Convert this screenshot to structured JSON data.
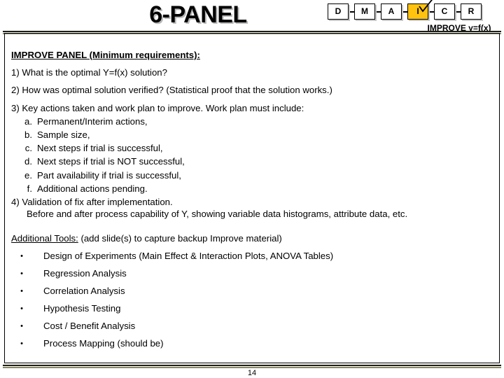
{
  "header": {
    "title": "6-PANEL",
    "phase_label": "IMPROVE y=f(x)",
    "roadmap": {
      "steps": [
        {
          "label": "D",
          "active": false
        },
        {
          "label": "M",
          "active": false
        },
        {
          "label": "A",
          "active": false
        },
        {
          "label": "I",
          "active": true
        },
        {
          "label": "C",
          "active": false
        },
        {
          "label": "R",
          "active": false
        }
      ],
      "active_marker_icon": "checkmark-icon",
      "active_color": "#FFC20E"
    }
  },
  "body": {
    "section_heading": "IMPROVE PANEL  (Minimum requirements):",
    "numbered_items": [
      "1) What is the optimal Y=f(x) solution?",
      "2) How was optimal solution verified?  (Statistical proof that the solution works.)",
      "3) Key actions taken and work plan to improve.  Work plan must include:"
    ],
    "sub_items": [
      {
        "marker": "a.",
        "text": "Permanent/Interim actions,"
      },
      {
        "marker": "b.",
        "text": "Sample size,"
      },
      {
        "marker": "c.",
        "text": "Next steps if trial is successful,"
      },
      {
        "marker": "d.",
        "text": "Next steps if trial is NOT successful,"
      },
      {
        "marker": "e.",
        "text": "Part availability if trial is successful,"
      },
      {
        "marker": "f.",
        "text": "Additional actions pending."
      }
    ],
    "item_four": "4) Validation of fix after implementation.",
    "item_four_continuation": "Before and after process capability of Y, showing variable data histograms, attribute data, etc.",
    "tools_heading_underlined": "Additional Tools:",
    "tools_heading_rest": " (add slide(s) to capture backup Improve material)",
    "tools_bullet_glyph": "•",
    "tools": [
      "Design of Experiments (Main Effect & Interaction Plots, ANOVA Tables)",
      "Regression Analysis",
      "Correlation Analysis",
      "Hypothesis Testing",
      "Cost / Benefit Analysis",
      "Process Mapping (should be)"
    ]
  },
  "footer": {
    "page_number": "14"
  }
}
